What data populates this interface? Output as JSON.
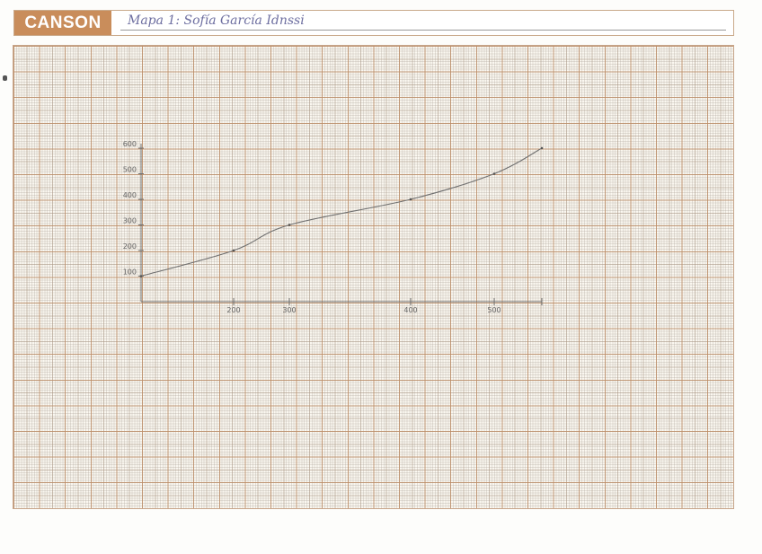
{
  "header": {
    "brand": "CANSON",
    "title": "Mapa 1: Sofía García Idnssi"
  },
  "chart_data": {
    "type": "line",
    "title": "Mapa 1: Sofía García Idnssi",
    "xlabel": "",
    "ylabel": "",
    "x_tick_labels": [
      "",
      "200",
      "300",
      "400",
      "500",
      ""
    ],
    "y_tick_labels": [
      "100",
      "200",
      "300",
      "400",
      "500",
      "600"
    ],
    "ylim": [
      0,
      600
    ],
    "grid": true,
    "series": [
      {
        "name": "curve",
        "points": [
          {
            "x": "origin",
            "y": 100
          },
          {
            "x": "200",
            "y": 200
          },
          {
            "x": "300",
            "y": 300
          },
          {
            "x": "400",
            "y": 400
          },
          {
            "x": "500",
            "y": 500
          },
          {
            "x": "end",
            "y": 600
          }
        ]
      }
    ],
    "color": "#707070"
  }
}
